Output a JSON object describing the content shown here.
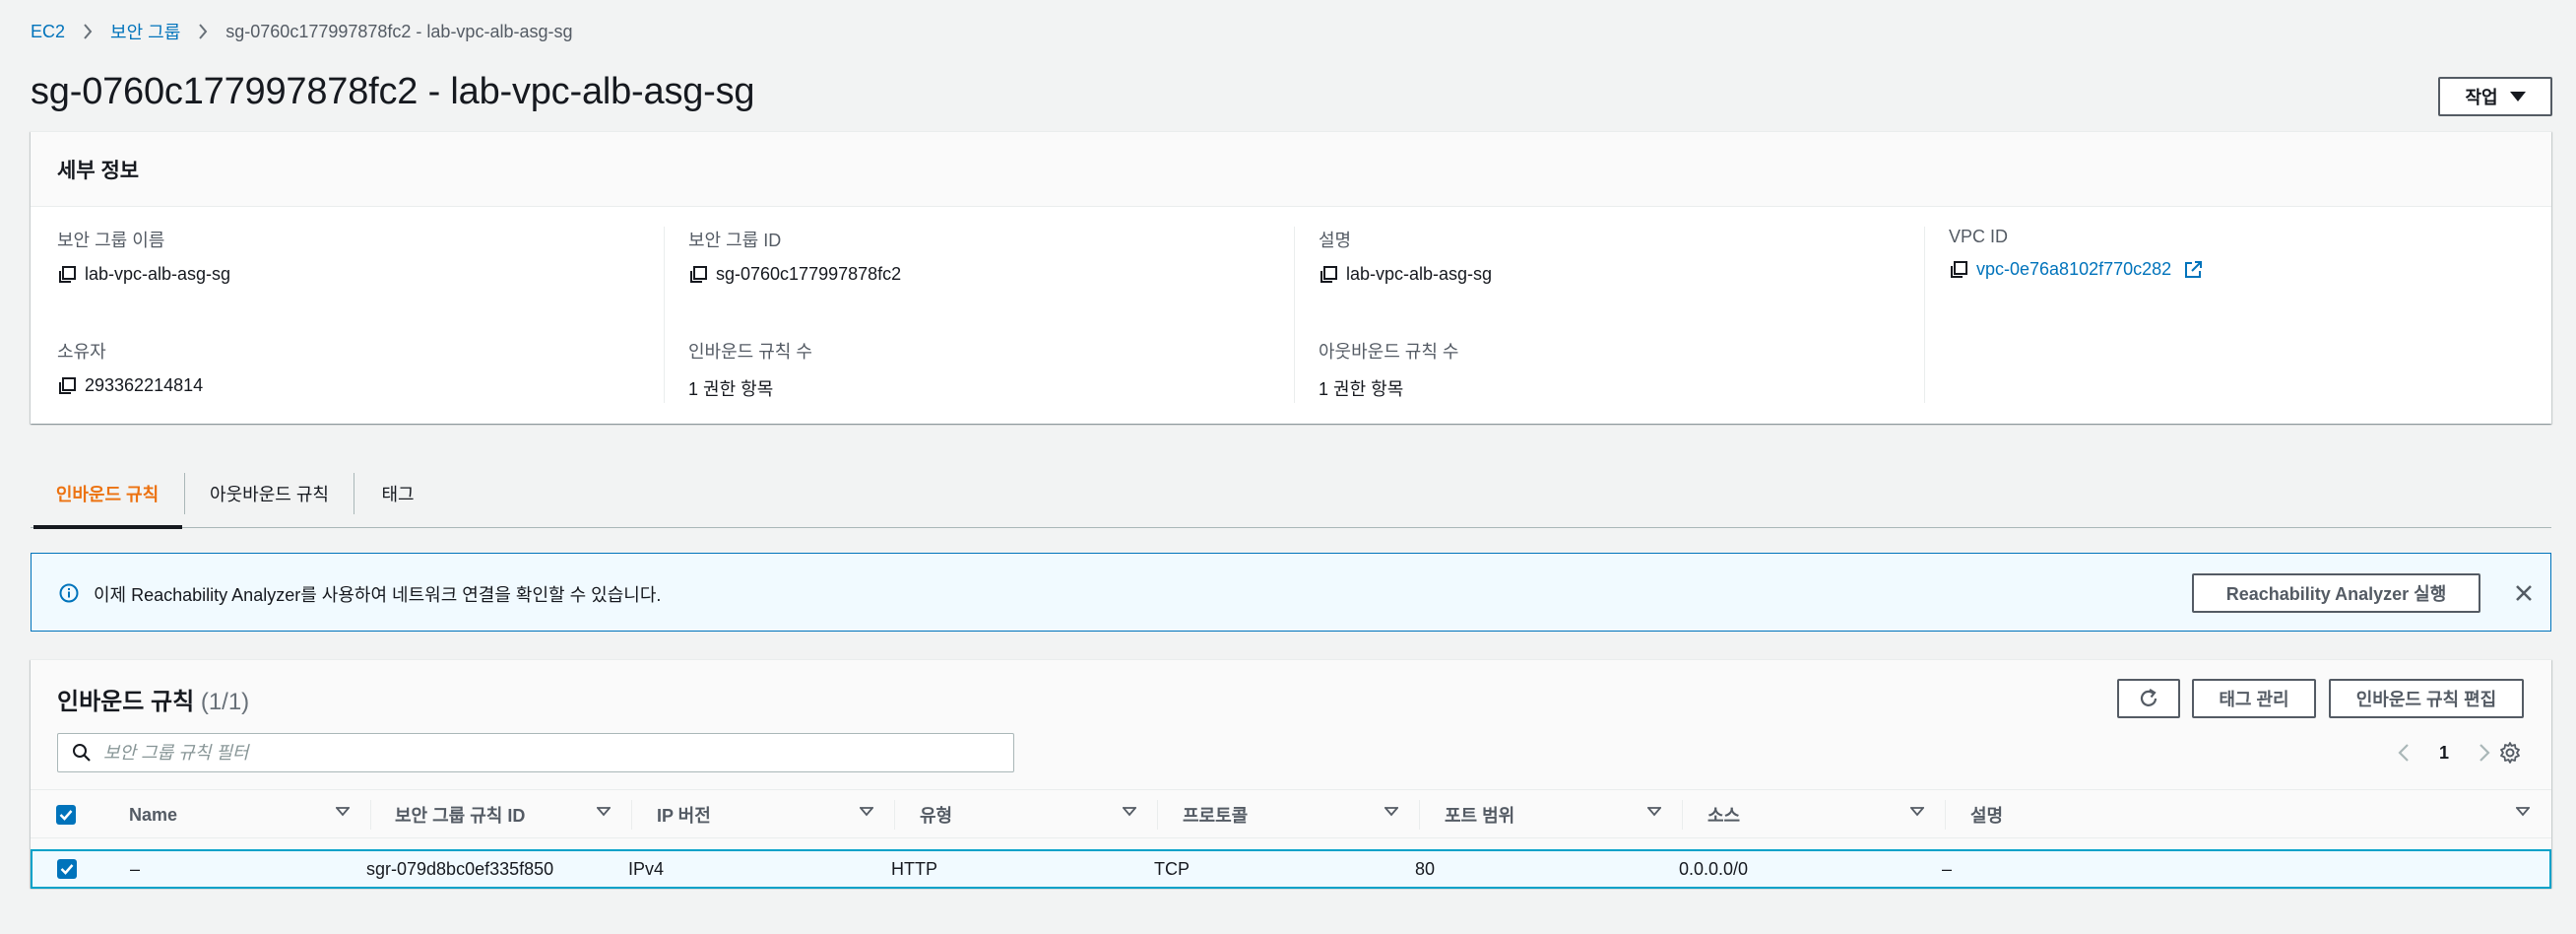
{
  "breadcrumb": {
    "ec2": "EC2",
    "security_groups": "보안 그룹",
    "current": "sg-0760c177997878fc2 - lab-vpc-alb-asg-sg"
  },
  "page_title": "sg-0760c177997878fc2 - lab-vpc-alb-asg-sg",
  "actions_label": "작업",
  "details": {
    "title": "세부 정보",
    "sg_name_label": "보안 그룹 이름",
    "sg_name_value": "lab-vpc-alb-asg-sg",
    "sg_id_label": "보안 그룹 ID",
    "sg_id_value": "sg-0760c177997878fc2",
    "description_label": "설명",
    "description_value": "lab-vpc-alb-asg-sg",
    "vpc_id_label": "VPC ID",
    "vpc_id_value": "vpc-0e76a8102f770c282",
    "owner_label": "소유자",
    "owner_value": "293362214814",
    "inbound_count_label": "인바운드 규칙 수",
    "inbound_count_value": "1 권한 항목",
    "outbound_count_label": "아웃바운드 규칙 수",
    "outbound_count_value": "1 권한 항목"
  },
  "tabs": [
    {
      "label": "인바운드 규칙",
      "active": true
    },
    {
      "label": "아웃바운드 규칙",
      "active": false
    },
    {
      "label": "태그",
      "active": false
    }
  ],
  "alert": {
    "text": "이제 Reachability Analyzer를 사용하여 네트워크 연결을 확인할 수 있습니다.",
    "button": "Reachability Analyzer 실행"
  },
  "rules": {
    "title": "인바운드 규칙",
    "count": "(1/1)",
    "manage_tags": "태그 관리",
    "edit_rules": "인바운드 규칙 편집",
    "filter_placeholder": "보안 그룹 규칙 필터",
    "page": "1",
    "columns": [
      "Name",
      "보안 그룹 규칙 ID",
      "IP 버전",
      "유형",
      "프로토콜",
      "포트 범위",
      "소스",
      "설명"
    ],
    "rows": [
      {
        "name": "–",
        "rule_id": "sgr-079d8bc0ef335f850",
        "ip_version": "IPv4",
        "type": "HTTP",
        "protocol": "TCP",
        "port_range": "80",
        "source": "0.0.0.0/0",
        "description": "–"
      }
    ]
  },
  "colors": {
    "link": "#0073bb",
    "active_tab": "#ec7211",
    "alert_bg": "#f1faff",
    "selected_row_border": "#00a1c9"
  }
}
